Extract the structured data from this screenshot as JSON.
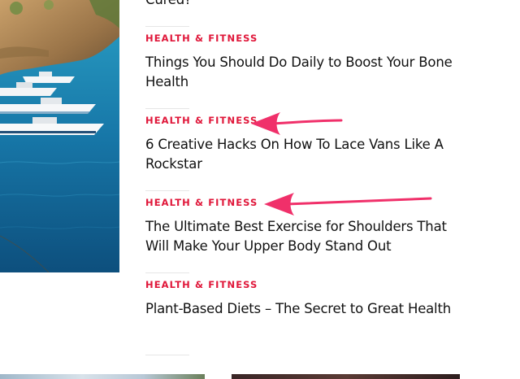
{
  "colors": {
    "category": "#e0173a",
    "title": "#111111",
    "arrow": "#f0306a"
  },
  "posts": [
    {
      "title": "Cured?"
    },
    {
      "category": "HEALTH & FITNESS",
      "title": "Things You Should Do Daily to Boost Your Bone Health"
    },
    {
      "category": "HEALTH & FITNESS",
      "title": "6 Creative Hacks On How To Lace Vans Like A Rockstar"
    },
    {
      "category": "HEALTH & FITNESS",
      "title": "The Ultimate Best Exercise for Shoulders That Will Make Your Upper Body Stand Out"
    },
    {
      "category": "HEALTH & FITNESS",
      "title": "Plant-Based Diets – The Secret to Great Health"
    }
  ],
  "annotations": [
    {
      "icon": "arrow-icon",
      "points_to": "HEALTH & FITNESS"
    },
    {
      "icon": "arrow-icon",
      "points_to": "HEALTH & FITNESS"
    }
  ]
}
